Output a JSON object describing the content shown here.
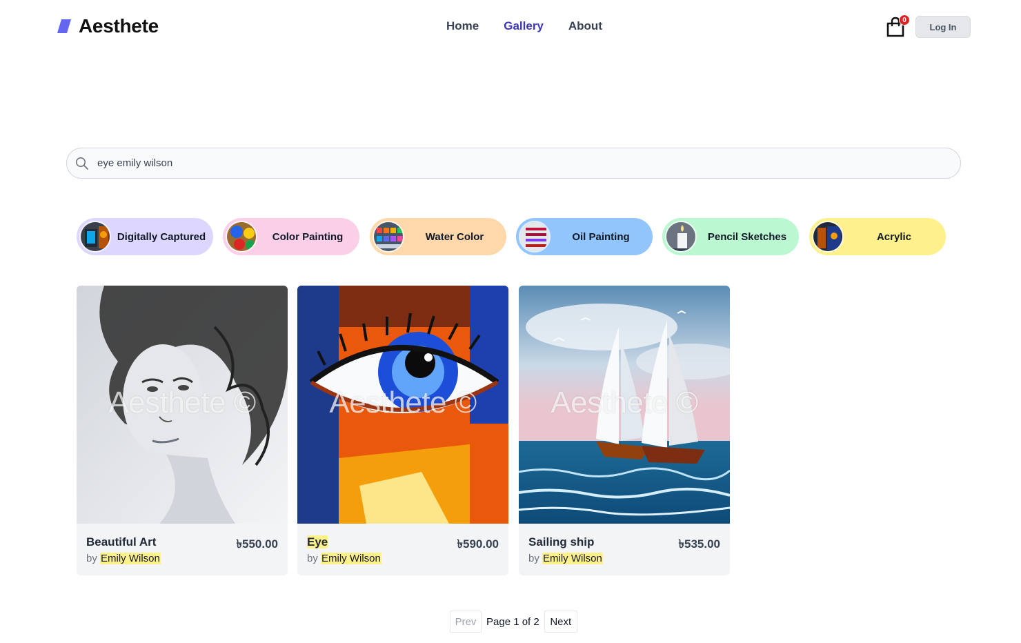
{
  "brand": {
    "name": "Aesthete",
    "accent": "#6366f1"
  },
  "nav": {
    "items": [
      {
        "label": "Home",
        "active": false
      },
      {
        "label": "Gallery",
        "active": true
      },
      {
        "label": "About",
        "active": false
      }
    ]
  },
  "cart": {
    "icon": "shopping-bag-icon",
    "count": "0"
  },
  "auth": {
    "login_label": "Log In"
  },
  "search": {
    "value": "eye emily wilson",
    "icon": "search-icon"
  },
  "categories": [
    {
      "label": "Digitally Captured",
      "color": "#ddd6fe"
    },
    {
      "label": "Color Painting",
      "color": "#fbcfe8"
    },
    {
      "label": "Water Color",
      "color": "#fed7aa"
    },
    {
      "label": "Oil Painting",
      "color": "#93c5fd"
    },
    {
      "label": "Pencil Sketches",
      "color": "#bbf7d0"
    },
    {
      "label": "Acrylic",
      "color": "#fef08a"
    }
  ],
  "artworks": [
    {
      "title": "Beautiful Art",
      "price": "৳550.00",
      "by": "by",
      "artist": "Emily Wilson",
      "watermark": "Aesthete ©"
    },
    {
      "title": "Eye",
      "price": "৳590.00",
      "by": "by",
      "artist": "Emily Wilson",
      "watermark": "Aesthete ©"
    },
    {
      "title": "Sailing ship",
      "price": "৳535.00",
      "by": "by",
      "artist": "Emily Wilson",
      "watermark": "Aesthete ©"
    }
  ],
  "pagination": {
    "prev_label": "Prev",
    "page_text": "Page 1 of 2",
    "next_label": "Next"
  }
}
